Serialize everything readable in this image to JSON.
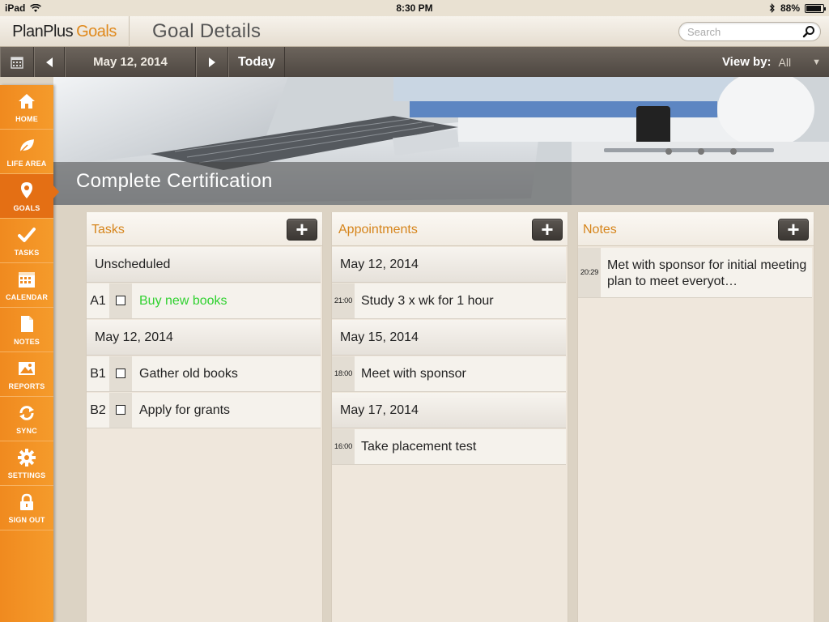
{
  "status_bar": {
    "device": "iPad",
    "time": "8:30 PM",
    "battery_percent": "88%",
    "battery_level": 0.88
  },
  "header": {
    "brand_primary": "PlanPlus",
    "brand_secondary": "Goals",
    "page_title": "Goal Details",
    "search_placeholder": "Search"
  },
  "toolbar": {
    "date": "May 12, 2014",
    "today_label": "Today",
    "view_by_label": "View by:",
    "view_by_value": "All"
  },
  "sidebar": {
    "items": [
      {
        "label": "HOME",
        "icon": "home-icon"
      },
      {
        "label": "LIFE AREA",
        "icon": "leaf-icon"
      },
      {
        "label": "GOALS",
        "icon": "map-pin-icon",
        "active": true
      },
      {
        "label": "TASKS",
        "icon": "checkmark-icon"
      },
      {
        "label": "CALENDAR",
        "icon": "calendar-icon"
      },
      {
        "label": "NOTES",
        "icon": "document-icon"
      },
      {
        "label": "REPORTS",
        "icon": "image-icon"
      },
      {
        "label": "SYNC",
        "icon": "sync-icon"
      },
      {
        "label": "SETTINGS",
        "icon": "gear-icon"
      },
      {
        "label": "SIGN OUT",
        "icon": "lock-icon"
      }
    ]
  },
  "goal": {
    "title": "Complete Certification"
  },
  "tasks_panel": {
    "title": "Tasks",
    "sections": [
      {
        "header": "Unscheduled",
        "rows": [
          {
            "priority": "A1",
            "text": "Buy new books",
            "color": "#2fd12f"
          }
        ]
      },
      {
        "header": "May 12, 2014",
        "rows": [
          {
            "priority": "B1",
            "text": "Gather old books"
          },
          {
            "priority": "B2",
            "text": "Apply for grants"
          }
        ]
      }
    ]
  },
  "appointments_panel": {
    "title": "Appointments",
    "sections": [
      {
        "header": "May 12, 2014",
        "rows": [
          {
            "time": "21:00",
            "text": "Study 3 x wk for 1 hour"
          }
        ]
      },
      {
        "header": "May 15, 2014",
        "rows": [
          {
            "time": "18:00",
            "text": "Meet with sponsor"
          }
        ]
      },
      {
        "header": "May 17, 2014",
        "rows": [
          {
            "time": "16:00",
            "text": "Take placement test"
          }
        ]
      }
    ]
  },
  "notes_panel": {
    "title": "Notes",
    "rows": [
      {
        "time": "20:29",
        "text": "Met with sponsor for initial meeting plan to meet everyot…"
      }
    ]
  },
  "colors": {
    "accent_orange": "#f08a1f",
    "brand_gold": "#e08a1e",
    "panel_title": "#d6851c",
    "completed_task": "#2fd12f"
  }
}
